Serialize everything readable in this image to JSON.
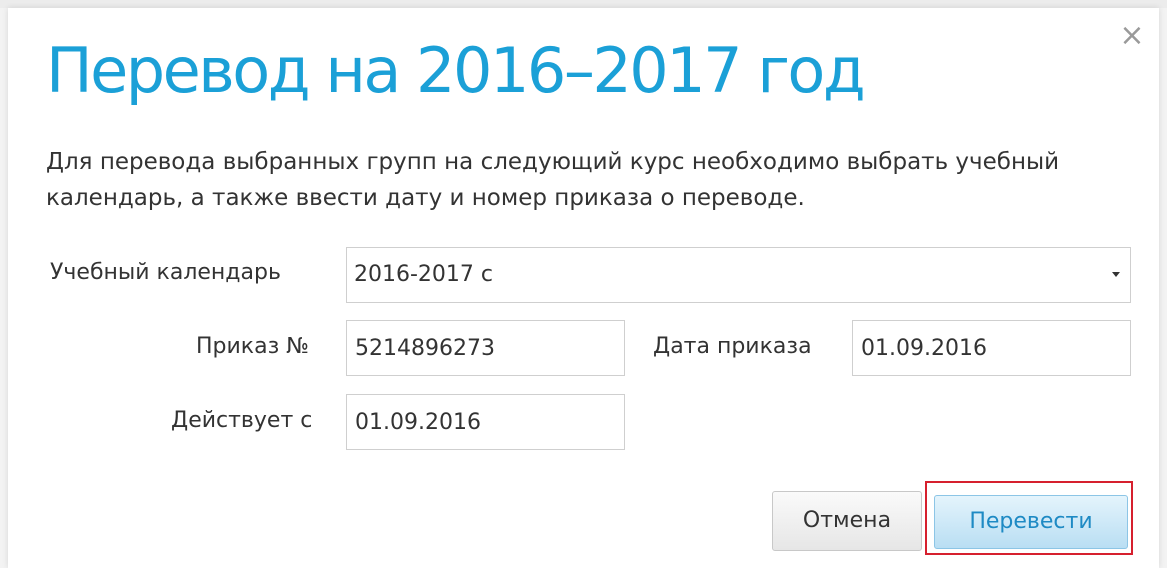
{
  "dialog": {
    "title": "Перевод на 2016–2017 год",
    "close_glyph": "×",
    "description": "Для перевода выбранных групп на следующий курс необходимо выбрать учебный календарь, а также ввести дату и номер приказа о переводе."
  },
  "form": {
    "calendar": {
      "label": "Учебный календарь",
      "value": "2016-2017 с"
    },
    "order_number": {
      "label": "Приказ №",
      "value": "5214896273"
    },
    "order_date": {
      "label": "Дата приказа",
      "value": "01.09.2016"
    },
    "effective_from": {
      "label": "Действует с",
      "value": "01.09.2016"
    }
  },
  "buttons": {
    "cancel": "Отмена",
    "submit": "Перевести"
  },
  "colors": {
    "title": "#1ba0d7",
    "submit_text": "#1e8ac4",
    "highlight_border": "#d6202e"
  },
  "icons": {
    "close": "close-icon",
    "dropdown": "chevron-down-icon"
  }
}
